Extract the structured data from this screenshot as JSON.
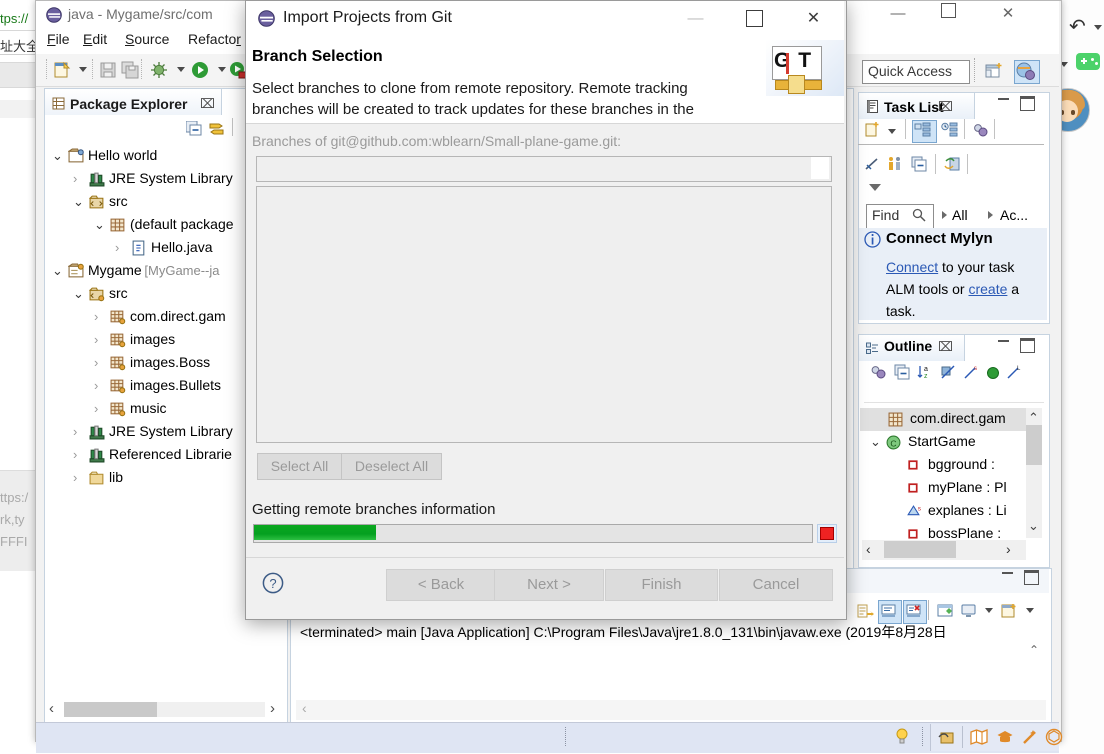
{
  "background_browser": {
    "url_text": "tps://",
    "bookmarks_text": "址大全",
    "page_lines": [
      "ttps:/",
      "rk,ty",
      "FFFI"
    ]
  },
  "eclipse": {
    "title": "java - Mygame/src/com",
    "title_icon": "eclipse-icon",
    "window_buttons": {
      "minimize": "—",
      "maximize": "⬜",
      "close": "✕"
    },
    "menu": [
      {
        "name": "file",
        "label": "File",
        "mnemonic": "F"
      },
      {
        "name": "edit",
        "label": "Edit",
        "mnemonic": "E"
      },
      {
        "name": "source",
        "label": "Source",
        "mnemonic": "S"
      },
      {
        "name": "refactor",
        "label": "Refacto",
        "mnemonic": "R"
      }
    ],
    "toolbar_icons": [
      "new-wizard-icon",
      "new-dropdown-arrow",
      "save-icon",
      "save-all-icon",
      "debug-icon",
      "debug-dropdown-arrow",
      "run-icon",
      "run-dropdown-arrow",
      "external-tools-icon"
    ],
    "quick_access": {
      "placeholder": "Quick Access",
      "value": "Quick Access"
    },
    "perspective": {
      "open_label": "open-perspective-icon",
      "java_label": "java-perspective-icon"
    }
  },
  "package_explorer": {
    "tab_label": "Package Explorer",
    "tab_icon": "package-explorer-icon",
    "close_glyph": "⌧",
    "toolbar_icons": [
      "collapse-all-icon",
      "link-with-editor-icon",
      "view-menu-icon"
    ],
    "view_buttons": {
      "minimize": "minimize-icon",
      "maximize": "maximize-icon"
    },
    "tree": [
      {
        "depth": 0,
        "twisty": "down",
        "icon": "java-project-icon",
        "label": "Hello world",
        "sub": ""
      },
      {
        "depth": 1,
        "twisty": "right",
        "icon": "library-icon",
        "label": "JRE System Library",
        "sub": ""
      },
      {
        "depth": 1,
        "twisty": "down",
        "icon": "source-folder-icon",
        "label": "src",
        "sub": ""
      },
      {
        "depth": 2,
        "twisty": "down",
        "icon": "package-icon",
        "label": "(default package",
        "sub": ""
      },
      {
        "depth": 3,
        "twisty": "right",
        "icon": "java-file-icon",
        "label": "Hello.java",
        "sub": ""
      },
      {
        "depth": 0,
        "twisty": "down",
        "icon": "git-project-icon",
        "label": "Mygame",
        "sub": "[MyGame--ja"
      },
      {
        "depth": 1,
        "twisty": "down",
        "icon": "source-folder-git-icon",
        "label": "src",
        "sub": ""
      },
      {
        "depth": 2,
        "twisty": "right",
        "icon": "package-git-icon",
        "label": "com.direct.gam",
        "sub": ""
      },
      {
        "depth": 2,
        "twisty": "right",
        "icon": "package-git-icon",
        "label": "images",
        "sub": ""
      },
      {
        "depth": 2,
        "twisty": "right",
        "icon": "package-git-icon",
        "label": "images.Boss",
        "sub": ""
      },
      {
        "depth": 2,
        "twisty": "right",
        "icon": "package-git-icon",
        "label": "images.Bullets",
        "sub": ""
      },
      {
        "depth": 2,
        "twisty": "right",
        "icon": "package-git-icon",
        "label": "music",
        "sub": ""
      },
      {
        "depth": 1,
        "twisty": "right",
        "icon": "library-icon",
        "label": "JRE System Library",
        "sub": ""
      },
      {
        "depth": 1,
        "twisty": "right",
        "icon": "library-icon",
        "label": "Referenced Librarie",
        "sub": ""
      },
      {
        "depth": 1,
        "twisty": "right",
        "icon": "folder-icon",
        "label": "lib",
        "sub": ""
      }
    ],
    "hscroll": {
      "left_arrow": "‹",
      "right_arrow": "›"
    }
  },
  "task_list": {
    "tab_label": "Task List",
    "tab_icon": "task-list-icon",
    "close_glyph": "⌧",
    "toolbar_icons": [
      "new-task-icon",
      "new-task-dropdown",
      "categorized-icon",
      "scheduled-icon",
      "synchronize-icon",
      "focus-icon",
      "presentation-icon",
      "collapse-all-icon",
      "restore-icon",
      "view-menu-icon"
    ],
    "find": {
      "label": "Find",
      "icon": "search-icon",
      "placeholder": "Find"
    },
    "filters": [
      "All",
      "Ac..."
    ],
    "connect": {
      "icon": "info-icon",
      "title": "Connect Mylyn",
      "line1_link": "Connect",
      "line1_rest": " to your task",
      "line2_pre": "ALM tools or ",
      "line2_link": "create",
      "line2_rest": " a",
      "line3": "task."
    }
  },
  "outline": {
    "tab_label": "Outline",
    "tab_icon": "outline-icon",
    "close_glyph": "⌧",
    "toolbar_icons": [
      "sync-icon",
      "collapse-all-icon",
      "sort-icon",
      "hide-fields-icon",
      "hide-static-icon",
      "hide-nonpublic-icon",
      "hide-local-icon"
    ],
    "rows": [
      {
        "indent": 28,
        "twisty": "",
        "icon": "package-icon",
        "label": "com.direct.gam",
        "selected": true
      },
      {
        "indent": 10,
        "twisty": "down",
        "icon": "class-icon",
        "label": "StartGame",
        "selected": false
      },
      {
        "indent": 46,
        "twisty": "",
        "icon": "field-private-icon",
        "label": "bgground : ",
        "selected": false
      },
      {
        "indent": 46,
        "twisty": "",
        "icon": "field-private-icon",
        "label": "myPlane : Pl",
        "selected": false
      },
      {
        "indent": 46,
        "twisty": "",
        "icon": "field-static-icon",
        "label": "explanes : Li",
        "selected": false
      },
      {
        "indent": 46,
        "twisty": "",
        "icon": "field-private-icon",
        "label": "bossPlane : ",
        "selected": false
      }
    ],
    "scroll": {
      "up": "⌃",
      "down": "⌄",
      "left": "‹",
      "right": "›"
    }
  },
  "console": {
    "toolbar_icons": [
      "remove-launch-icon",
      "remove-all-icon",
      "show-console-icon",
      "show-console-error-icon",
      "open-console-icon",
      "display-selected-console-icon",
      "display-dropdown-arrow",
      "new-console-icon",
      "new-console-dropdown"
    ],
    "view_buttons": {
      "minimize": "minimize-icon",
      "maximize": "maximize-icon"
    },
    "text": "<terminated> main [Java Application] C:\\Program Files\\Java\\jre1.8.0_131\\bin\\javaw.exe (2019年8月28日"
  },
  "status_bar": {
    "icons": [
      "quick-fix-bulb-icon",
      "feedback-icon",
      "map-icon",
      "learn-icon",
      "magic-wand-icon",
      "badge-icon"
    ]
  },
  "right_dock": {
    "undo_icon": "undo-arrow-icon",
    "game_icon": "game-controller-icon",
    "avatar": "user-avatar"
  },
  "dialog": {
    "title": "Import Projects from Git",
    "title_icon": "eclipse-icon",
    "window_buttons": {
      "minimize": "—",
      "maximize": "⬜",
      "close": "✕"
    },
    "heading": "Branch Selection",
    "description_line1": "Select branches to clone from remote repository. Remote tracking",
    "description_line2": "branches will be created to track updates for these branches in the",
    "banner": {
      "name": "git-banner-icon",
      "letters": "GIT"
    },
    "branches_label": "Branches of git@github.com:wblearn/Small-plane-game.git:",
    "filter_value": "",
    "filter_placeholder": "",
    "list_items": [],
    "select_all_label": "Select All",
    "deselect_all_label": "Deselect All",
    "progress_label": "Getting remote branches information",
    "progress_percent": 22,
    "progress_color": "#0aa81f",
    "progress_cancel_icon": "stop-icon",
    "help_icon": "help-icon",
    "buttons": [
      {
        "name": "back",
        "label": "< Back",
        "enabled": false
      },
      {
        "name": "next",
        "label": "Next >",
        "enabled": false
      },
      {
        "name": "finish",
        "label": "Finish",
        "enabled": false
      },
      {
        "name": "cancel",
        "label": "Cancel",
        "enabled": false
      }
    ]
  }
}
